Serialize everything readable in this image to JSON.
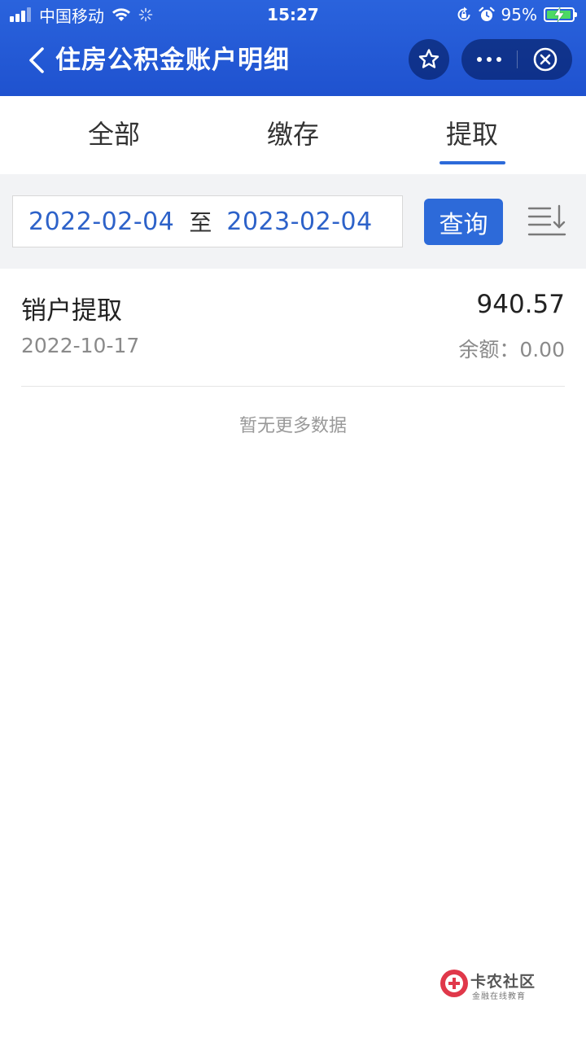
{
  "status_bar": {
    "carrier": "中国移动",
    "time": "15:27",
    "battery_percent": "95%",
    "battery_level": 0.95,
    "icons": [
      "signal-icon",
      "wifi-icon",
      "loading-icon",
      "screen-lock-icon",
      "alarm-icon",
      "battery-icon"
    ]
  },
  "nav": {
    "title": "住房公积金账户明细",
    "icons": [
      "back-chevron-icon",
      "star-icon",
      "more-dots-icon",
      "close-circle-icon"
    ]
  },
  "tabs": [
    {
      "label": "全部",
      "active": false
    },
    {
      "label": "缴存",
      "active": false
    },
    {
      "label": "提取",
      "active": true
    }
  ],
  "filter": {
    "start_date": "2022-02-04",
    "separator": "至",
    "end_date": "2023-02-04",
    "query_label": "查询",
    "sort_icon": "sort-descending-icon"
  },
  "records": [
    {
      "title": "销户提取",
      "amount": "940.57",
      "date": "2022-10-17",
      "balance": "余额：0.00"
    }
  ],
  "no_more_text": "暂无更多数据",
  "watermark": {
    "name": "卡农社区",
    "slogan": "金融在线教育"
  },
  "colors": {
    "header_blue": "#2a63dd",
    "accent_blue": "#2d6ad9",
    "date_text_blue": "#2d62c9",
    "filter_bg": "#f2f3f5",
    "watermark_red": "#e0384a"
  }
}
